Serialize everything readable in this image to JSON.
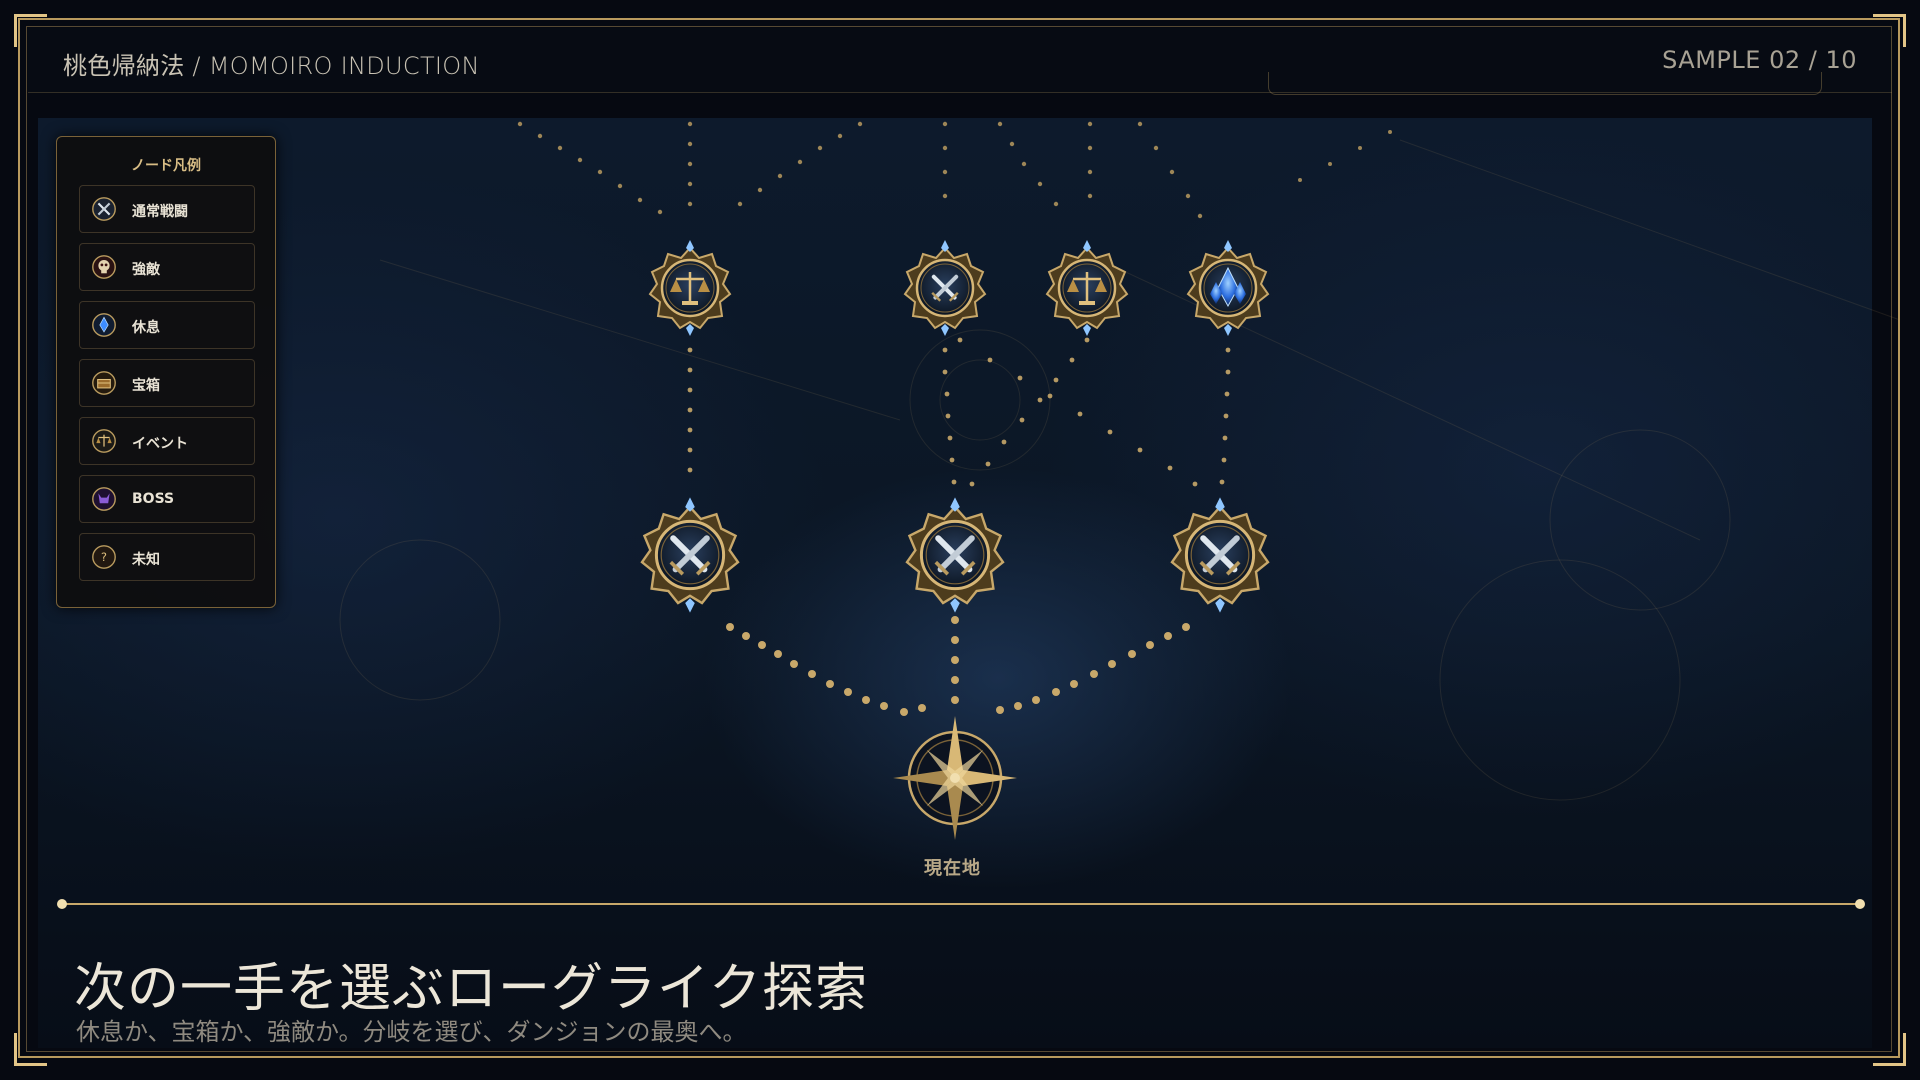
{
  "header": {
    "brand": "桃色帰納法 / MOMOIRO INDUCTION",
    "sample": "SAMPLE 02 / 10"
  },
  "legend": {
    "title": "ノード凡例",
    "items": [
      {
        "label": "通常戦闘",
        "icon": "crossed-swords-icon"
      },
      {
        "label": "強敵",
        "icon": "skull-icon"
      },
      {
        "label": "休息",
        "icon": "crystal-icon"
      },
      {
        "label": "宝箱",
        "icon": "treasure-chest-icon"
      },
      {
        "label": "イベント",
        "icon": "scales-icon"
      },
      {
        "label": "BOSS",
        "icon": "demon-icon"
      },
      {
        "label": "未知",
        "icon": "question-icon"
      }
    ]
  },
  "map": {
    "current_label": "現在地",
    "nodes_row1": [
      "event",
      "battle",
      "event",
      "rest"
    ],
    "nodes_row2": [
      "battle",
      "battle",
      "battle"
    ],
    "current_node": "compass"
  },
  "caption": {
    "headline": "次の一手を選ぶローグライク探索",
    "subline": "休息か、宝箱か、強敵か。分岐を選び、ダンジョンの最奥へ。"
  },
  "colors": {
    "gold": "#c8a86a",
    "steel": "#c9d3dc",
    "crystal": "#3d8cff",
    "background": "#0b1624"
  }
}
